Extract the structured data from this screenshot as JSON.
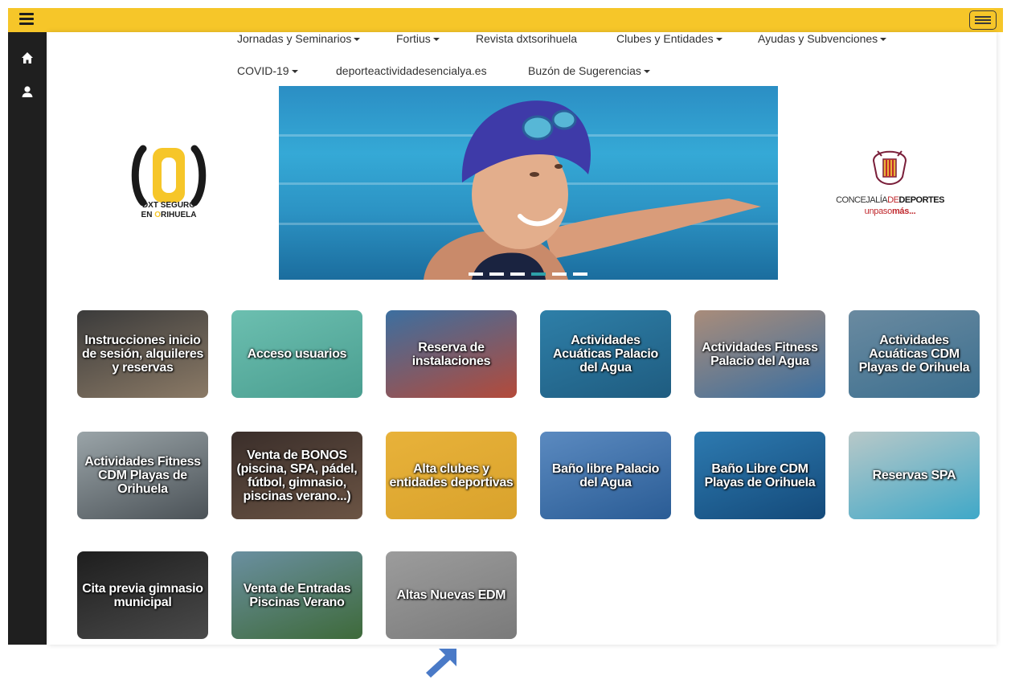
{
  "nav": {
    "row1": [
      {
        "label": "Jornadas y Seminarios",
        "dropdown": true
      },
      {
        "label": "Fortius",
        "dropdown": true
      },
      {
        "label": "Revista dxtsorihuela",
        "dropdown": false
      },
      {
        "label": "Clubes y Entidades",
        "dropdown": true
      },
      {
        "label": "Ayudas y Subvenciones",
        "dropdown": true
      }
    ],
    "row2": [
      {
        "label": "COVID-19",
        "dropdown": true
      },
      {
        "label": "deporteactividadesencialya.es",
        "dropdown": false
      },
      {
        "label": "Buzón de Sugerencias",
        "dropdown": true
      }
    ]
  },
  "logos": {
    "left": {
      "glyph": "(0)",
      "line1": "DXT SEGURO",
      "line2_pre": "EN ",
      "line2_highlight": "O",
      "line2_post": "RIHUELA"
    },
    "right": {
      "line1_a": "CONCEJALÍA",
      "line1_b": "DE",
      "line1_c": "DEPORTES",
      "line2_a": "unpaso",
      "line2_b": "más..."
    }
  },
  "carousel": {
    "slide_count": 6,
    "active_index": 3
  },
  "tiles": [
    {
      "label": "Instrucciones inicio de sesión, alquileres y reservas",
      "bg": "#3b3b3b",
      "bg2": "#8b7a66"
    },
    {
      "label": "Acceso usuarios",
      "bg": "#6cbfb0",
      "bg2": "#4a9e90"
    },
    {
      "label": "Reserva de instalaciones",
      "bg": "#3c6fa0",
      "bg2": "#b44a3a"
    },
    {
      "label": "Actividades Acuáticas Palacio del Agua",
      "bg": "#2e7fa8",
      "bg2": "#1f5c80"
    },
    {
      "label": "Actividades Fitness Palacio del Agua",
      "bg": "#a98c7a",
      "bg2": "#3b6fa0"
    },
    {
      "label": "Actividades Acuáticas CDM Playas de Orihuela",
      "bg": "#6a8aa0",
      "bg2": "#3c6f8f"
    },
    {
      "label": "Actividades Fitness CDM Playas de Orihuela",
      "bg": "#9aa4a8",
      "bg2": "#4b5257"
    },
    {
      "label": "Venta de BONOS (piscina, SPA, pádel, fútbol, gimnasio, piscinas verano...)",
      "bg": "#3a2e2a",
      "bg2": "#6b5444"
    },
    {
      "label": "Alta clubes y entidades deportivas",
      "bg": "#e8b23a",
      "bg2": "#d9a22c"
    },
    {
      "label": "Baño libre Palacio del Agua",
      "bg": "#5b8ac0",
      "bg2": "#2a5c95"
    },
    {
      "label": "Baño Libre CDM Playas de Orihuela",
      "bg": "#2d7ab0",
      "bg2": "#144a7a"
    },
    {
      "label": "Reservas SPA",
      "bg": "#b8c8c8",
      "bg2": "#3fa8c8"
    },
    {
      "label": "Cita previa gimnasio municipal",
      "bg": "#1e1e1e",
      "bg2": "#4a4a4a"
    },
    {
      "label": "Venta de Entradas Piscinas Verano",
      "bg": "#6a8fa0",
      "bg2": "#3e6a3a"
    },
    {
      "label": "Altas Nuevas EDM",
      "bg": "#9c9c9c",
      "bg2": "#7a7a7a"
    }
  ],
  "colors": {
    "topbar": "#f6c629",
    "sidebar": "#1f1f1f",
    "arrow": "#4a7ac7"
  }
}
